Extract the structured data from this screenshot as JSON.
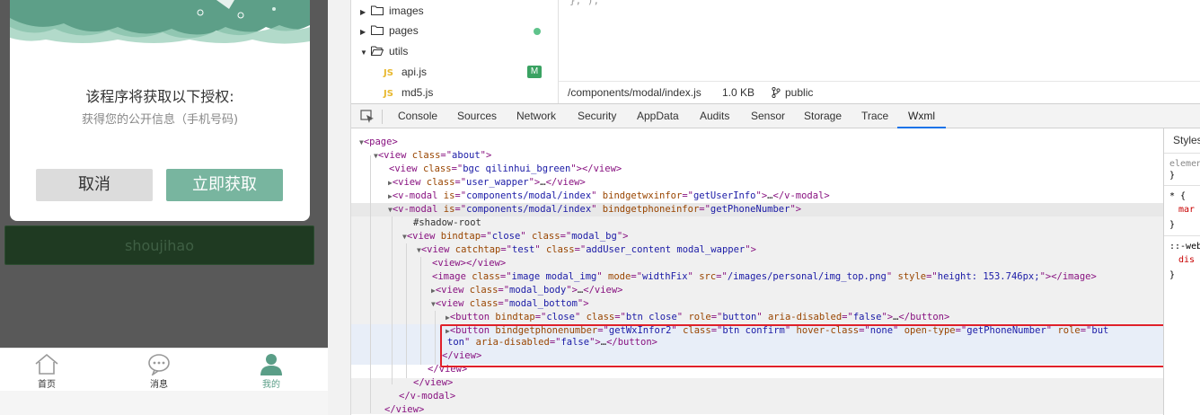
{
  "simulator": {
    "modal": {
      "title": "该程序将获取以下授权:",
      "desc": "获得您的公开信息（手机号码)",
      "cancel_label": "取消",
      "confirm_label": "立即获取"
    },
    "green_bar_text": "shoujihao",
    "tabbar": [
      {
        "label": "首页",
        "icon": "home-icon"
      },
      {
        "label": "消息",
        "icon": "message-icon"
      },
      {
        "label": "我的",
        "icon": "user-icon"
      }
    ],
    "colors": {
      "accent": "#78b59f",
      "active_tab": "#5a9e87"
    }
  },
  "filetree": {
    "items": [
      "images",
      "pages",
      "utils",
      "api.js",
      "md5.js"
    ],
    "badge_m": "M"
  },
  "editor": {
    "code_fragment": "}, );"
  },
  "fileinfo": {
    "path": "/components/modal/index.js",
    "size": "1.0 KB",
    "branch": "public"
  },
  "devtools": {
    "tabs": [
      "Console",
      "Sources",
      "Network",
      "Security",
      "AppData",
      "Audits",
      "Sensor",
      "Storage",
      "Trace",
      "Wxml"
    ],
    "active_tab": "Wxml"
  },
  "dom": {
    "l01_tag": "page",
    "l02_tag": "view",
    "l02_attr": "class",
    "l02_val": "about",
    "l03_tag": "view",
    "l03_attr": "class",
    "l03_val": "bgc qilinhui_bgreen",
    "l04_tag": "view",
    "l04_attr": "class",
    "l04_val": "user_wapper",
    "l05_tag": "v-modal",
    "l05_a1": "is",
    "l05_v1": "components/modal/index",
    "l05_a2": "bindgetwxinfor",
    "l05_v2": "getUserInfo",
    "l06_tag": "v-modal",
    "l06_a1": "is",
    "l06_v1": "components/modal/index",
    "l06_a2": "bindgetphoneinfor",
    "l06_v2": "getPhoneNumber",
    "l07_text": "#shadow-root",
    "l08_tag": "view",
    "l08_a1": "bindtap",
    "l08_v1": "close",
    "l08_a2": "class",
    "l08_v2": "modal_bg",
    "l09_tag": "view",
    "l09_a1": "catchtap",
    "l09_v1": "test",
    "l09_a2": "class",
    "l09_v2": "addUser_content modal_wapper",
    "l10_tag": "view",
    "l11_tag": "image",
    "l11_a1": "class",
    "l11_v1": "image modal_img",
    "l11_a2": "mode",
    "l11_v2": "widthFix",
    "l11_a3": "src",
    "l11_v3": "/images/personal/img_top.png",
    "l11_a4": "style",
    "l11_v4": "height: 153.746px;",
    "l12_tag": "view",
    "l12_attr": "class",
    "l12_val": "modal_body",
    "l13_tag": "view",
    "l13_attr": "class",
    "l13_val": "modal_bottom",
    "l14_tag": "button",
    "l14_a1": "bindtap",
    "l14_v1": "close",
    "l14_a2": "class",
    "l14_v2": "btn close",
    "l14_a3": "role",
    "l14_v3": "button",
    "l14_a4": "aria-disabled",
    "l14_v4": "false",
    "l15_tag": "button",
    "l15_a1": "bindgetphonenumber",
    "l15_v1": "getWxInfor2",
    "l15_a2": "class",
    "l15_v2": "btn confirm",
    "l15_a3": "hover-class",
    "l15_v3": "none",
    "l15_a4": "open-type",
    "l15_v4": "getPhoneNumber",
    "l15_a5": "role",
    "l15_v5_part1": "but",
    "l16_v5_part2": "ton",
    "l16_a6": "aria-disabled",
    "l16_v6": "false",
    "l17_close": "view",
    "l18_close": "view",
    "l19_close": "view",
    "l20_close": "v-modal",
    "l21_close": "view"
  },
  "styles": {
    "header": "Styles",
    "r1": "elemen",
    "r1_end": "}",
    "r2_sel": "* {",
    "r2_prop": "mar",
    "r2_end": "}",
    "r3_sel": "::-web",
    "r3_prop": "dis",
    "r3_end": "}"
  }
}
